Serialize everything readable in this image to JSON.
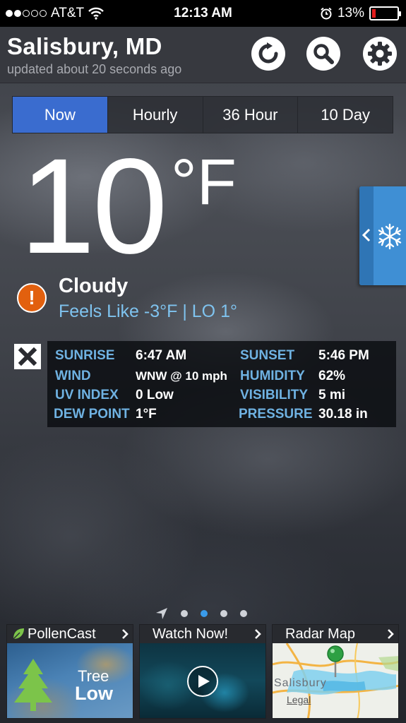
{
  "status_bar": {
    "carrier": "AT&T",
    "time": "12:13 AM",
    "battery": "13%"
  },
  "header": {
    "city": "Salisbury, MD",
    "updated": "updated about 20 seconds ago",
    "icons": [
      "refresh-icon",
      "search-icon",
      "settings-icon"
    ]
  },
  "tabs": [
    {
      "label": "Now",
      "active": true
    },
    {
      "label": "Hourly",
      "active": false
    },
    {
      "label": "36 Hour",
      "active": false
    },
    {
      "label": "10 Day",
      "active": false
    }
  ],
  "current": {
    "temp": "10",
    "unit": "°F",
    "condition": "Cloudy",
    "feels_like": "Feels Like -3°F |  LO 1°"
  },
  "details": {
    "sunrise_label": "SUNRISE",
    "sunrise": "6:47 AM",
    "sunset_label": "SUNSET",
    "sunset": "5:46 PM",
    "wind_label": "WIND",
    "wind": "WNW @ 10 mph",
    "humidity_label": "HUMIDITY",
    "humidity": "62%",
    "uv_label": "UV INDEX",
    "uv": "0 Low",
    "visibility_label": "VISIBILITY",
    "visibility": "5 mi",
    "dew_label": "DEW POINT",
    "dew": "1°F",
    "pressure_label": "PRESSURE",
    "pressure": "30.18 in"
  },
  "pager": {
    "pages": 4,
    "active": 1
  },
  "cards": {
    "pollen": {
      "title": "PollenCast",
      "type": "Tree",
      "level": "Low"
    },
    "video": {
      "title": "Watch Now!"
    },
    "radar": {
      "title": "Radar Map",
      "map_label": "Salisbury",
      "legal": "Legal"
    }
  },
  "colors": {
    "accent": "#3a6ccf",
    "label_blue": "#6fb2e2",
    "alert_orange": "#e2600e",
    "battery_red": "#e31b1b",
    "snow_tab": "#3f8fd4"
  }
}
